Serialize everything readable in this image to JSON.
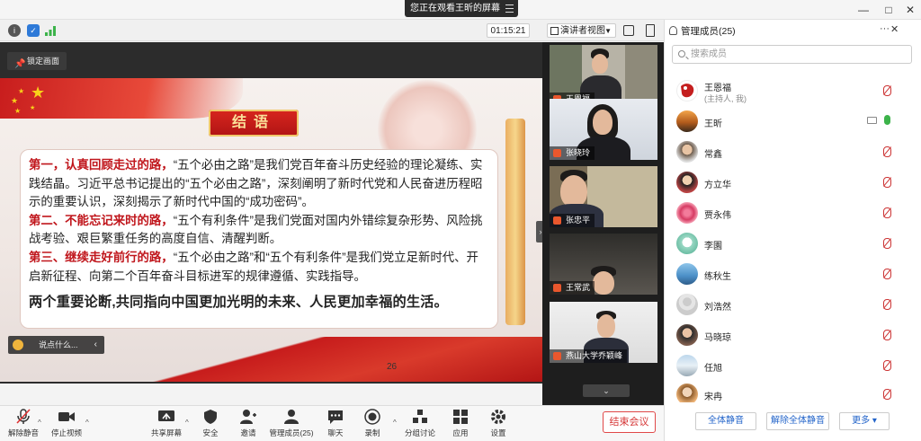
{
  "title_bar": {
    "sharing_banner": "您正在观看王昕的屏幕",
    "min": "—",
    "max": "□",
    "close": "✕"
  },
  "info_bar": {
    "timer": "01:15:21",
    "view_mode": "演讲者视图"
  },
  "share": {
    "lock_label": "锁定画面",
    "chat_placeholder": "说点什么...",
    "slide": {
      "heading": "结语",
      "p1_lead": "第一，认真回顾走过的路，",
      "p1_body": "“五个必由之路”是我们党百年奋斗历史经验的理论凝练、实践结晶。习近平总书记提出的“五个必由之路”，深刻阐明了新时代党和人民奋进历程昭示的重要认识，深刻揭示了新时代中国的“成功密码”。",
      "p2_lead": "第二、不能忘记来时的路，",
      "p2_body": "“五个有利条件”是我们党面对国内外错综复杂形势、风险挑战考验、艰巨繁重任务的高度自信、清醒判断。",
      "p3_lead": "第三、继续走好前行的路，",
      "p3_body": "“五个必由之路”和“五个有利条件”是我们党立足新时代、开启新征程、向第二个百年奋斗目标进军的规律遵循、实践指导。",
      "summary": "两个重要论断,共同指向中国更加光明的未来、人民更加幸福的生活。",
      "page_number": "26"
    }
  },
  "videos": [
    {
      "name": "王恩福"
    },
    {
      "name": "张晓玲"
    },
    {
      "name": "张忠平"
    },
    {
      "name": "王常武"
    },
    {
      "name": "燕山大学乔颖峰"
    }
  ],
  "toolbar": {
    "unmute": "解除静音",
    "stop_video": "停止视频",
    "share_screen": "共享屏幕",
    "security": "安全",
    "invite": "邀请",
    "manage_members": "管理成员(25)",
    "chat": "聊天",
    "record": "录制",
    "breakout": "分组讨论",
    "apps": "应用",
    "settings": "设置",
    "end_meeting": "结束会议"
  },
  "panel": {
    "title": "管理成员(25)",
    "search_placeholder": "搜索成员",
    "members": [
      {
        "name": "王恩福",
        "sub": "(主持人, 我)"
      },
      {
        "name": "王昕"
      },
      {
        "name": "常鑫"
      },
      {
        "name": "方立华"
      },
      {
        "name": "贾永伟"
      },
      {
        "name": "李園"
      },
      {
        "name": "练秋生"
      },
      {
        "name": "刘浩然"
      },
      {
        "name": "马晓琼"
      },
      {
        "name": "任旭"
      },
      {
        "name": "宋冉"
      }
    ],
    "mute_all": "全体静音",
    "unmute_all": "解除全体静音",
    "more": "更多 ▾"
  },
  "colors": {
    "end_red": "#d63737",
    "link_blue": "#2163c9",
    "slide_red": "#c0161c"
  }
}
